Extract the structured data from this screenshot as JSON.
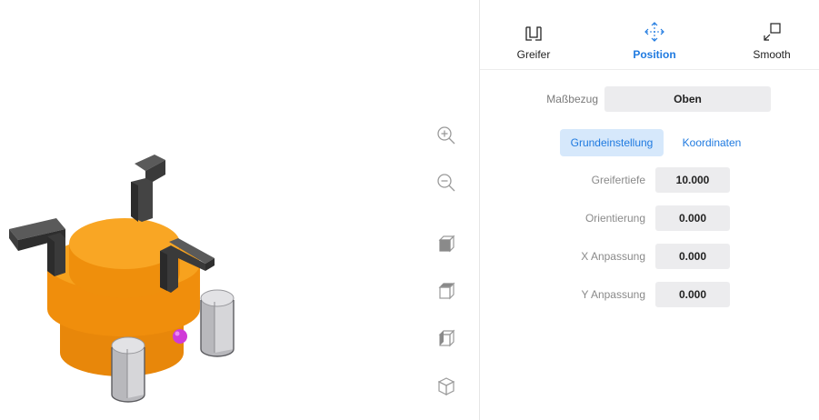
{
  "viewport": {
    "tools": [
      {
        "name": "zoom-in-icon"
      },
      {
        "name": "zoom-out-icon"
      },
      {
        "name": "view-front-icon"
      },
      {
        "name": "view-top-icon"
      },
      {
        "name": "view-side-icon"
      },
      {
        "name": "view-iso-icon"
      }
    ],
    "colors": {
      "part": "#f39a12",
      "gripper": "#4a4a4a",
      "cylinder": "#cfcfd2",
      "marker": "#d03ad8"
    }
  },
  "tabs": [
    {
      "label": "Greifer",
      "icon": "gripper-icon",
      "active": false
    },
    {
      "label": "Position",
      "icon": "move-icon",
      "active": true
    },
    {
      "label": "Smooth",
      "icon": "smooth-icon",
      "active": false
    }
  ],
  "reference": {
    "label": "Maßbezug",
    "value": "Oben"
  },
  "modes": {
    "basic": "Grundeinstellung",
    "coordinates": "Koordinaten"
  },
  "fields": [
    {
      "label": "Greifertiefe",
      "value": "10.000"
    },
    {
      "label": "Orientierung",
      "value": "0.000"
    },
    {
      "label": "X Anpassung",
      "value": "0.000"
    },
    {
      "label": "Y Anpassung",
      "value": "0.000"
    }
  ],
  "colors": {
    "accent": "#1f7ae0",
    "accent_bg": "#d6e8fb",
    "input_bg": "#ececee"
  }
}
